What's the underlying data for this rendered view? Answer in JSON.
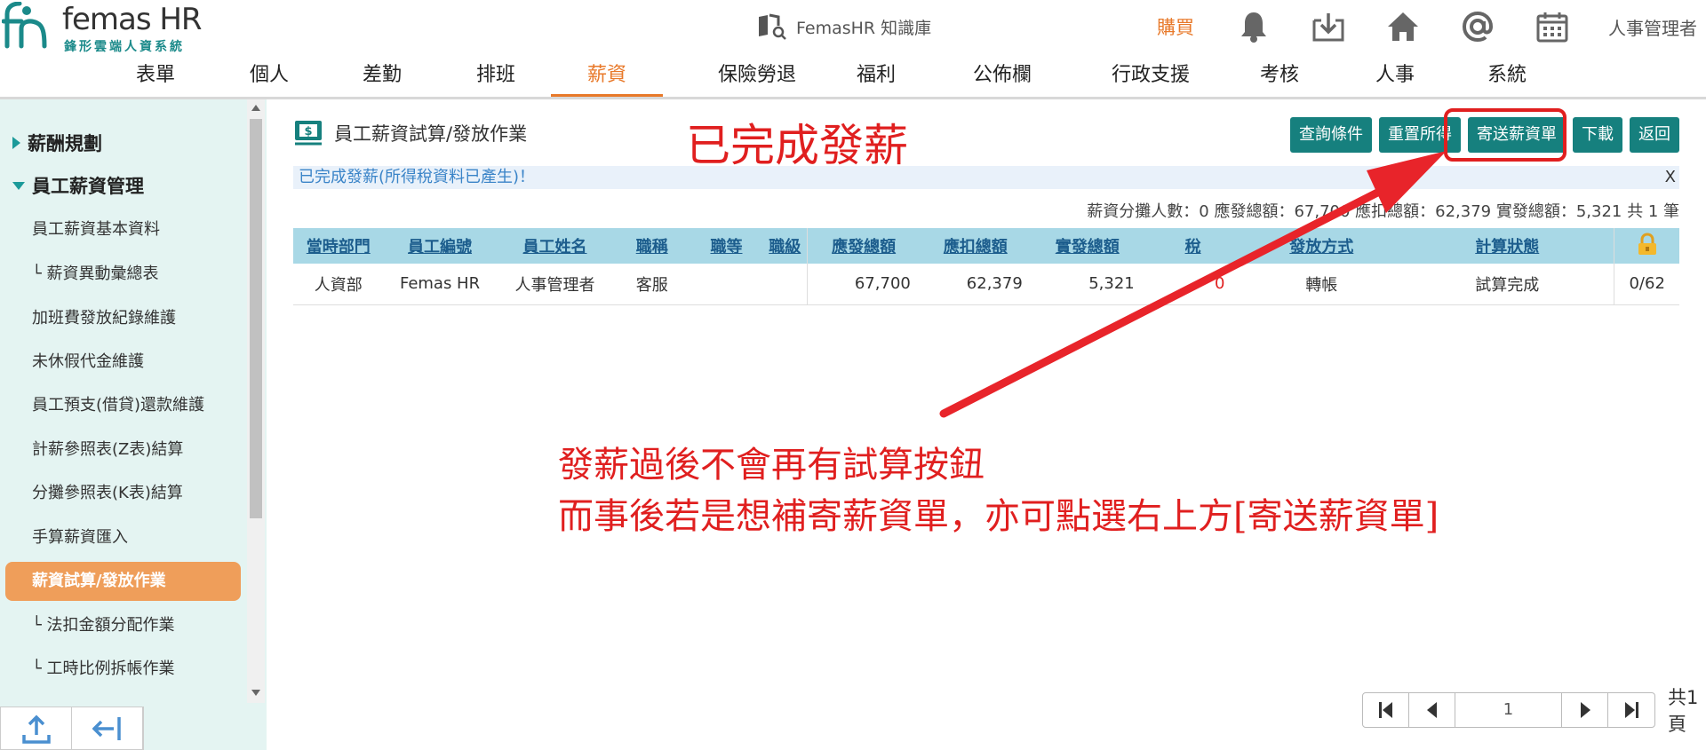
{
  "header": {
    "logo_title": "femas HR",
    "logo_sub": "鋒形雲端人資系統",
    "knowledge_base": "FemasHR 知識庫",
    "buy": "購買",
    "user": "人事管理者"
  },
  "nav": [
    {
      "label": "表單"
    },
    {
      "label": "個人"
    },
    {
      "label": "差勤"
    },
    {
      "label": "排班"
    },
    {
      "label": "薪資"
    },
    {
      "label": "保險勞退"
    },
    {
      "label": "福利"
    },
    {
      "label": "公佈欄"
    },
    {
      "label": "行政支援"
    },
    {
      "label": "考核"
    },
    {
      "label": "人事"
    },
    {
      "label": "系統"
    }
  ],
  "sidebar": {
    "group1": "薪酬規劃",
    "group2": "員工薪資管理",
    "items": [
      "員工薪資基本資料",
      "└ 薪資異動彙總表",
      "加班費發放紀錄維護",
      "未休假代金維護",
      "員工預支(借貸)還款維護",
      "計薪參照表(Z表)結算",
      "分攤參照表(K表)結算",
      "手算薪資匯入",
      "薪資試算/發放作業",
      "└ 法扣金額分配作業",
      "└ 工時比例拆帳作業"
    ]
  },
  "page": {
    "title": "員工薪資試算/發放作業",
    "buttons": {
      "query": "查詢條件",
      "reset": "重置所得",
      "send": "寄送薪資單",
      "download": "下載",
      "back": "返回"
    },
    "alert": "已完成發薪(所得稅資料已產生)！",
    "alert_close": "X",
    "summary": "薪資分攤人數：0 應發總額：67,700 應扣總額：62,379 實發總額：5,321 共 1 筆"
  },
  "table": {
    "headers": [
      "當時部門",
      "員工編號",
      "員工姓名",
      "職稱",
      "職等",
      "職級",
      "應發總額",
      "應扣總額",
      "實發總額",
      "稅",
      "發放方式",
      "計算狀態"
    ],
    "rows": [
      [
        "人資部",
        "Femas HR",
        "人事管理者",
        "客服",
        "",
        "",
        "67,700",
        "62,379",
        "5,321",
        "0",
        "轉帳",
        "試算完成",
        "0/62"
      ]
    ]
  },
  "pager": {
    "page": "1",
    "total": "共1頁"
  },
  "annotations": {
    "title": "已完成發薪",
    "line1": "發薪過後不會再有試算按鈕",
    "line2": "而事後若是想補寄薪資單，亦可點選右上方[寄送薪資單]"
  },
  "colors": {
    "accent": "#e8792a",
    "teal": "#16807e",
    "annotation_red": "#e01f1f"
  }
}
